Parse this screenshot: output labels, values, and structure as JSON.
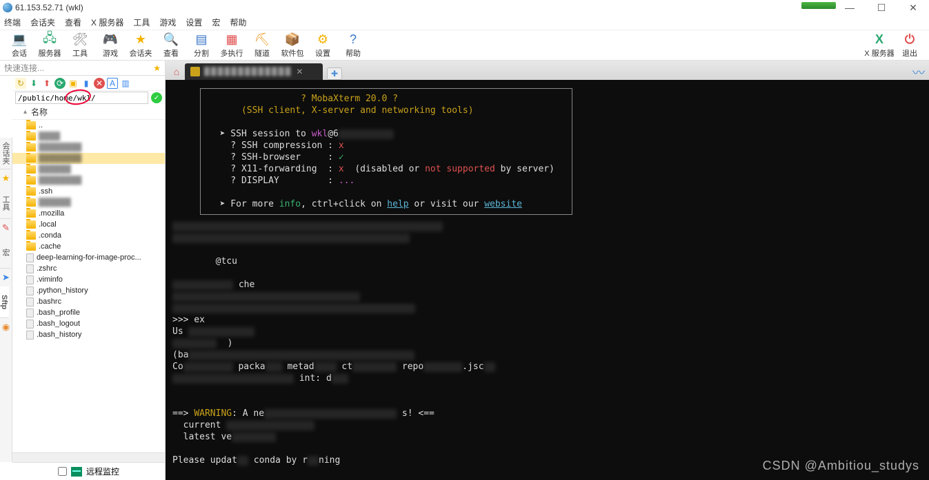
{
  "window": {
    "title": "61.153.52.71 (wkl)"
  },
  "menu": [
    "终端",
    "会话夹",
    "查看",
    "X 服务器",
    "工具",
    "游戏",
    "设置",
    "宏",
    "帮助"
  ],
  "toolbar": [
    {
      "id": "session",
      "label": "会话",
      "glyph": "💻",
      "color": "#3a76c8"
    },
    {
      "id": "server",
      "label": "服务器",
      "glyph": "🖧",
      "color": "#2aa870"
    },
    {
      "id": "tools",
      "label": "工具",
      "glyph": "🛠",
      "color": "#888"
    },
    {
      "id": "games",
      "label": "游戏",
      "glyph": "🎮",
      "color": "#c85cc8"
    },
    {
      "id": "sessfolder",
      "label": "会话夹",
      "glyph": "★",
      "color": "#f5b301"
    },
    {
      "id": "view",
      "label": "查看",
      "glyph": "🔍",
      "color": "#3a76c8"
    },
    {
      "id": "split",
      "label": "分割",
      "glyph": "▤",
      "color": "#3a76c8"
    },
    {
      "id": "multi",
      "label": "多执行",
      "glyph": "▦",
      "color": "#e05050"
    },
    {
      "id": "tunnel",
      "label": "隧道",
      "glyph": "⛏",
      "color": "#f0a030"
    },
    {
      "id": "pkg",
      "label": "软件包",
      "glyph": "📦",
      "color": "#3a86c8"
    },
    {
      "id": "settings",
      "label": "设置",
      "glyph": "⚙",
      "color": "#f5b301"
    },
    {
      "id": "help",
      "label": "帮助",
      "glyph": "?",
      "color": "#3a76c8"
    }
  ],
  "toolbar_right": [
    {
      "id": "xserver",
      "label": "X 服务器",
      "glyph": "X",
      "color": "#2aa870"
    },
    {
      "id": "exit",
      "label": "退出",
      "glyph": "⏻",
      "color": "#e05050"
    }
  ],
  "quick_connect": {
    "placeholder": "快速连接..."
  },
  "sidetabs": [
    "会话夹",
    "工具",
    "宏",
    "Sftp"
  ],
  "path": "/public/home/wkl/",
  "list_header": "名称",
  "files": [
    {
      "type": "folder",
      "label": "..",
      "pixel": false
    },
    {
      "type": "folder",
      "label": "████",
      "pixel": true
    },
    {
      "type": "folder",
      "label": "████████",
      "pixel": true
    },
    {
      "type": "folder",
      "label": "████████",
      "pixel": true,
      "sel": true
    },
    {
      "type": "folder",
      "label": "██████",
      "pixel": true
    },
    {
      "type": "folder",
      "label": "████████",
      "pixel": true
    },
    {
      "type": "folder",
      "label": ".ssh",
      "pixel": false
    },
    {
      "type": "folder",
      "label": "██████",
      "pixel": true
    },
    {
      "type": "folder",
      "label": ".mozilla",
      "pixel": false
    },
    {
      "type": "folder",
      "label": ".local",
      "pixel": false
    },
    {
      "type": "folder",
      "label": ".conda",
      "pixel": false
    },
    {
      "type": "folder",
      "label": ".cache",
      "pixel": false
    },
    {
      "type": "file",
      "label": "deep-learning-for-image-proc...",
      "pixel": false
    },
    {
      "type": "file",
      "label": ".zshrc",
      "pixel": false
    },
    {
      "type": "file",
      "label": ".viminfo",
      "pixel": false
    },
    {
      "type": "file",
      "label": ".python_history",
      "pixel": false
    },
    {
      "type": "file",
      "label": ".bashrc",
      "pixel": false
    },
    {
      "type": "file",
      "label": ".bash_profile",
      "pixel": false
    },
    {
      "type": "file",
      "label": ".bash_logout",
      "pixel": false
    },
    {
      "type": "file",
      "label": ".bash_history",
      "pixel": false
    }
  ],
  "remote_monitor": "远程监控",
  "terminal": {
    "banner_title": "? MobaXterm 20.0 ?",
    "banner_sub": "(SSH client, X-server and networking tools)",
    "session_line_prefix": "SSH session to ",
    "session_user": "wkl",
    "session_at": "@6",
    "rows": [
      {
        "k": "SSH compression",
        "v": "x",
        "ok": false
      },
      {
        "k": "SSH-browser",
        "v": "✓",
        "ok": true
      },
      {
        "k": "X11-forwarding",
        "v": "x",
        "ok": false,
        "extra": "(disabled or not supported by server)"
      },
      {
        "k": "DISPLAY",
        "v": "...",
        "ok": null
      }
    ],
    "footer_prefix": "For more ",
    "footer_info": "info",
    "footer_mid": ", ctrl+click on ",
    "footer_help": "help",
    "footer_mid2": " or visit our ",
    "footer_site": "website",
    "blur_lines": [
      "█████████████████████████████████████████████████",
      "███████████████████████████████████████████",
      "",
      "        @tcu",
      "",
      "███████████ che",
      "██████████████████████████████████",
      "████████████████████████████████████████████",
      ">>> ex",
      "Us ████████████",
      "████████  )",
      "(ba█████████████████████████████████████████",
      "Co█████████ packa███ metad████ ct████████ repo███████.jsc██",
      "██████████████████████ int: d███",
      "",
      "",
      "==> WARNING: A ne████████████████████████ s! <==",
      "  current ████████████████",
      "  latest ve████████",
      "",
      "Please updat██ conda by r██ning"
    ]
  },
  "watermark": "CSDN @Ambitiou_studys"
}
